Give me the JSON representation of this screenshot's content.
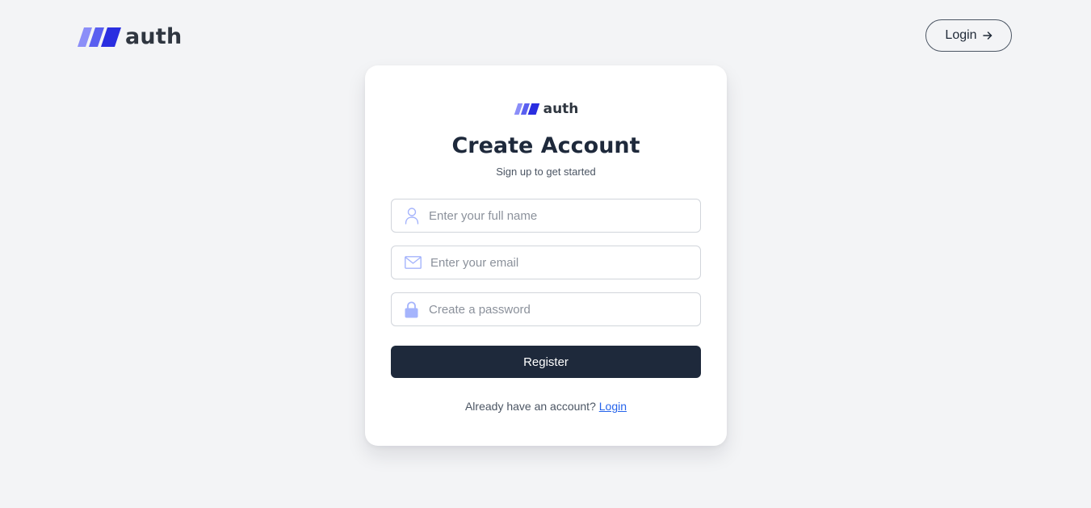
{
  "brand": {
    "name": "auth",
    "colors": {
      "stripe_light": "#8b8ef8",
      "stripe_mid": "#5a5ff0",
      "stripe_dark": "#2a2ee0",
      "text": "#2f3640"
    }
  },
  "header": {
    "login_label": "Login",
    "login_icon": "arrow-right-icon"
  },
  "card": {
    "title": "Create Account",
    "subtitle": "Sign up to get started",
    "fields": {
      "name": {
        "placeholder": "Enter your full name",
        "value": "",
        "icon": "user-icon"
      },
      "email": {
        "placeholder": "Enter your email",
        "value": "",
        "icon": "mail-icon"
      },
      "password": {
        "placeholder": "Create a password",
        "value": "",
        "icon": "lock-icon"
      }
    },
    "register_label": "Register",
    "footer": {
      "prompt": "Already have an account?",
      "link_label": "Login"
    }
  },
  "colors": {
    "page_background": "#f3f4f6",
    "card_background": "#ffffff",
    "primary_button": "#1e293b",
    "link": "#2563eb",
    "icon": "#a5b4fc"
  }
}
